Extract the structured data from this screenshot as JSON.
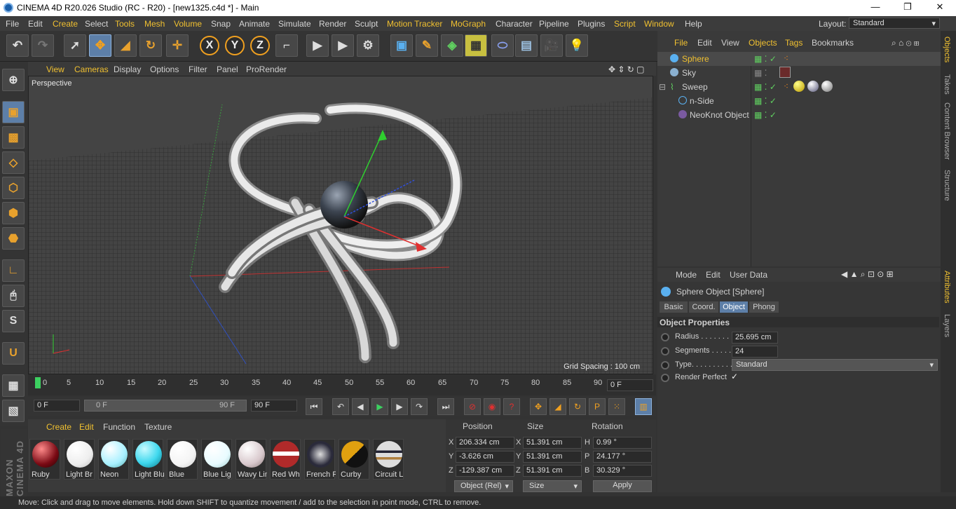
{
  "titlebar": {
    "title": "CINEMA 4D R20.026 Studio (RC - R20) - [new1325.c4d *] - Main"
  },
  "menubar": {
    "items": [
      "File",
      "Edit",
      "Create",
      "Select",
      "Tools",
      "Mesh",
      "Volume",
      "Snap",
      "Animate",
      "Simulate",
      "Render",
      "Sculpt",
      "Motion Tracker",
      "MoGraph",
      "Character",
      "Pipeline",
      "Plugins",
      "Script",
      "Window",
      "Help"
    ],
    "layout_label": "Layout:",
    "layout_value": "Standard"
  },
  "viewport": {
    "menu": [
      "View",
      "Cameras",
      "Display",
      "Options",
      "Filter",
      "Panel",
      "ProRender"
    ],
    "label": "Perspective",
    "grid_spacing": "Grid Spacing : 100 cm"
  },
  "timeline": {
    "ticks": [
      "0",
      "5",
      "10",
      "15",
      "20",
      "25",
      "30",
      "35",
      "40",
      "45",
      "50",
      "55",
      "60",
      "65",
      "70",
      "75",
      "80",
      "85",
      "90"
    ],
    "current_frame": "0 F",
    "start": "0 F",
    "range_start": "0 F",
    "range_end": "90 F",
    "end": "90 F"
  },
  "materials": {
    "menu": [
      "Create",
      "Edit",
      "Function",
      "Texture"
    ],
    "items": [
      {
        "name": "Ruby",
        "color": "#7a0a14"
      },
      {
        "name": "Light Br",
        "color": "#ffffff"
      },
      {
        "name": "Neon",
        "color": "#a8f0ff"
      },
      {
        "name": "Light Blu",
        "color": "#3fd8ee"
      },
      {
        "name": "Blue",
        "color": "#ffffff"
      },
      {
        "name": "Blue Lig",
        "color": "#e8fbff"
      },
      {
        "name": "Wavy Lin",
        "color": "#d8c8cc"
      },
      {
        "name": "Red Wh",
        "color": "#b02a2a"
      },
      {
        "name": "French F",
        "color": "#2a2a3a"
      },
      {
        "name": "Curby",
        "color": "#e0a010"
      },
      {
        "name": "Circuit L",
        "color": "#c8c8c8"
      }
    ]
  },
  "coords": {
    "headers": [
      "Position",
      "Size",
      "Rotation"
    ],
    "rows": [
      {
        "axis": "X",
        "pos": "206.334 cm",
        "saxis": "X",
        "size": "51.391 cm",
        "raxis": "H",
        "rot": "0.99 °"
      },
      {
        "axis": "Y",
        "pos": "-3.626 cm",
        "saxis": "Y",
        "size": "51.391 cm",
        "raxis": "P",
        "rot": "24.177 °"
      },
      {
        "axis": "Z",
        "pos": "-129.387 cm",
        "saxis": "Z",
        "size": "51.391 cm",
        "raxis": "B",
        "rot": "30.329 °"
      }
    ],
    "mode": "Object (Rel)",
    "size_mode": "Size",
    "apply": "Apply"
  },
  "objects": {
    "menu": [
      "File",
      "Edit",
      "View",
      "Objects",
      "Tags",
      "Bookmarks"
    ],
    "items": [
      {
        "name": "Sphere",
        "indent": 0,
        "selected": true
      },
      {
        "name": "Sky",
        "indent": 0,
        "selected": false
      },
      {
        "name": "Sweep",
        "indent": 0,
        "selected": false
      },
      {
        "name": "n-Side",
        "indent": 1,
        "selected": false
      },
      {
        "name": "NeoKnot Object",
        "indent": 1,
        "selected": false
      }
    ]
  },
  "attributes": {
    "menu": [
      "Mode",
      "Edit",
      "User Data"
    ],
    "title": "Sphere Object [Sphere]",
    "tabs": [
      "Basic",
      "Coord.",
      "Object",
      "Phong"
    ],
    "section": "Object Properties",
    "radius_label": "Radius . . . . . . .",
    "radius": "25.695 cm",
    "segments_label": "Segments . . . . .",
    "segments": "24",
    "type_label": "Type. . . . . . . . . .",
    "type": "Standard",
    "render_perfect_label": "Render Perfect",
    "render_perfect": "✓"
  },
  "sidetabs": [
    "Objects",
    "Takes",
    "Content Browser",
    "Structure",
    "Attributes",
    "Layers"
  ],
  "status": "Move: Click and drag to move elements. Hold down SHIFT to quantize movement / add to the selection in point mode, CTRL to remove.",
  "brand": "MAXON CINEMA 4D"
}
